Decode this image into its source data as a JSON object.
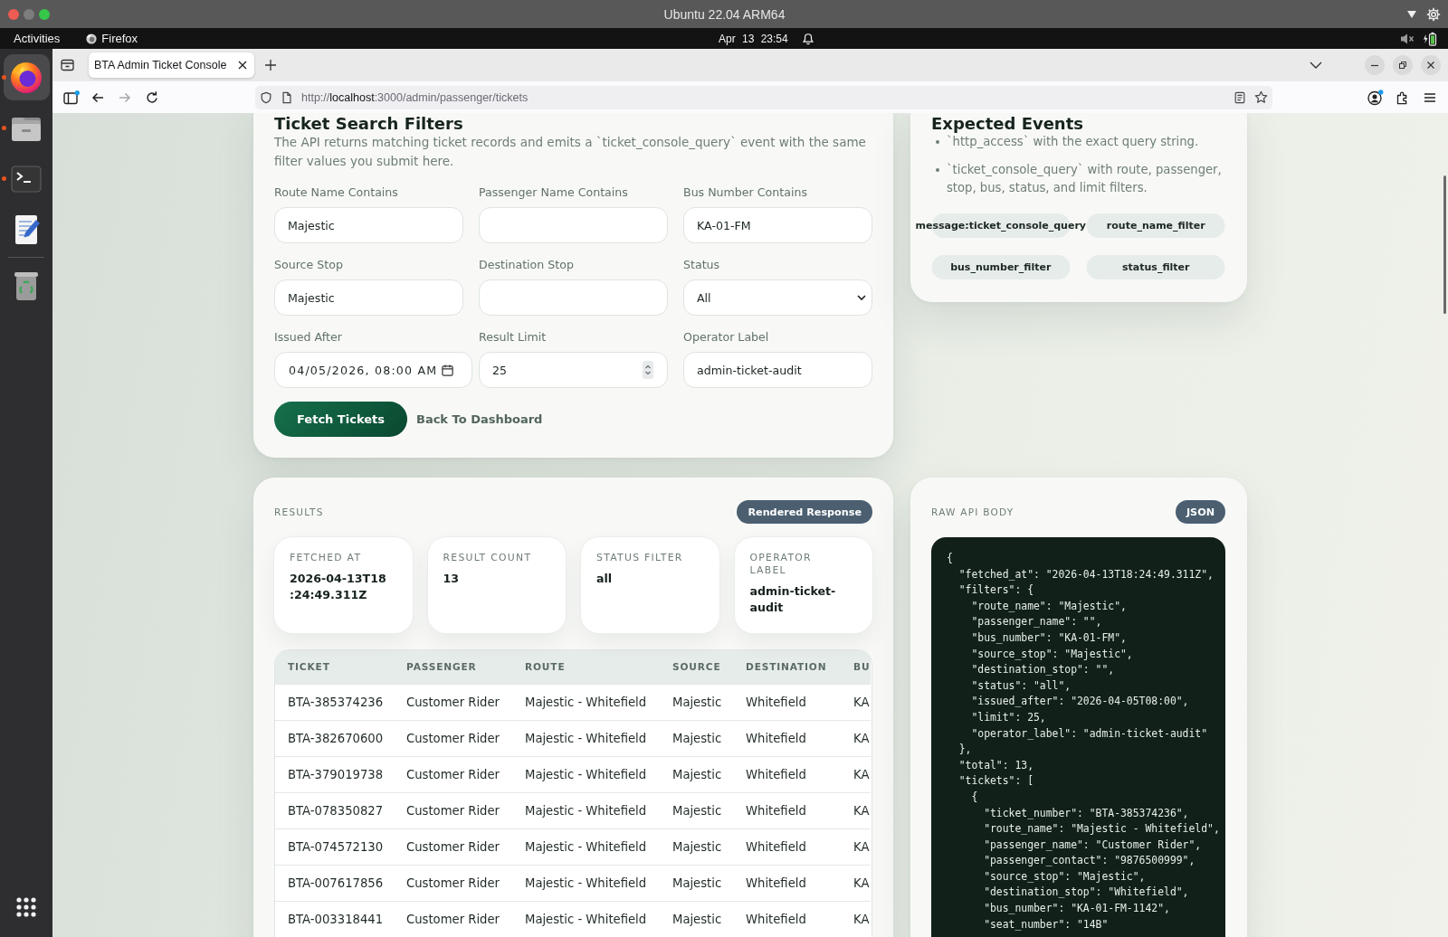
{
  "system_bar": {
    "title": "Ubuntu 22.04 ARM64"
  },
  "top_panel": {
    "activities": "Activities",
    "app_name": "Firefox",
    "clock": "Apr 13 23:54"
  },
  "dock": {
    "items": [
      {
        "kind": "browser",
        "selected": true,
        "running": true
      },
      {
        "kind": "files",
        "selected": false,
        "running": true
      },
      {
        "kind": "terminal",
        "selected": false,
        "running": true
      },
      {
        "kind": "editor",
        "selected": false,
        "running": false
      },
      {
        "kind": "trash",
        "selected": false,
        "running": false
      }
    ]
  },
  "browser": {
    "tabs": [
      {
        "title": "BTA Admin Ticket Console",
        "selected": true
      }
    ],
    "address": {
      "scheme": "http://",
      "host": "localhost",
      "path": ":3000/admin/passenger/tickets"
    }
  },
  "filters": {
    "heading": "Ticket Search Filters",
    "description": "The API returns matching ticket records and emits a `ticket_console_query` event with the same filter values you submit here.",
    "fields": [
      {
        "kind": "text",
        "label": "Route Name Contains",
        "value": "Majestic"
      },
      {
        "kind": "text",
        "label": "Passenger Name Contains"
      },
      {
        "kind": "text",
        "label": "Bus Number Contains",
        "value": "KA-01-FM"
      },
      {
        "kind": "text",
        "label": "Source Stop",
        "value": "Majestic"
      },
      {
        "kind": "text",
        "label": "Destination Stop"
      },
      {
        "kind": "select",
        "label": "Status",
        "value": "All"
      },
      {
        "kind": "datetime",
        "label": "Issued After",
        "value": "04/05/2026, 08:00 AM"
      },
      {
        "kind": "number",
        "label": "Result Limit",
        "value": "25"
      },
      {
        "kind": "text",
        "label": "Operator Label",
        "value": "admin-ticket-audit"
      }
    ],
    "actions": [
      {
        "kind": "primary",
        "label": "Fetch Tickets"
      },
      {
        "kind": "link",
        "label": "Back To Dashboard"
      }
    ]
  },
  "events": {
    "heading": "Expected Events",
    "items": [
      "`http_access` with the exact query string.",
      "`ticket_console_query` with route, passenger, stop, bus, status, and limit filters."
    ],
    "tags": [
      "message:ticket_console_query",
      "route_name_filter",
      "bus_number_filter",
      "status_filter"
    ]
  },
  "results": {
    "label": "RESULTS",
    "badge": "Rendered Response",
    "stats": [
      {
        "kind": "timestamp",
        "label": "FETCHED AT",
        "value": "2026-04-13T18:24:49.311Z"
      },
      {
        "kind": "text",
        "label": "RESULT COUNT",
        "value": "13"
      },
      {
        "kind": "text",
        "label": "STATUS FILTER",
        "value": "all"
      },
      {
        "kind": "text",
        "label": "OPERATOR LABEL",
        "value": "admin-ticket-audit"
      }
    ],
    "table": {
      "columns": [
        "TICKET",
        "PASSENGER",
        "ROUTE",
        "SOURCE",
        "DESTINATION",
        "BU"
      ],
      "rows": [
        [
          "BTA-385374236",
          "Customer Rider",
          "Majestic - Whitefield",
          "Majestic",
          "Whitefield",
          "KA"
        ],
        [
          "BTA-382670600",
          "Customer Rider",
          "Majestic - Whitefield",
          "Majestic",
          "Whitefield",
          "KA"
        ],
        [
          "BTA-379019738",
          "Customer Rider",
          "Majestic - Whitefield",
          "Majestic",
          "Whitefield",
          "KA"
        ],
        [
          "BTA-078350827",
          "Customer Rider",
          "Majestic - Whitefield",
          "Majestic",
          "Whitefield",
          "KA"
        ],
        [
          "BTA-074572130",
          "Customer Rider",
          "Majestic - Whitefield",
          "Majestic",
          "Whitefield",
          "KA"
        ],
        [
          "BTA-007617856",
          "Customer Rider",
          "Majestic - Whitefield",
          "Majestic",
          "Whitefield",
          "KA"
        ],
        [
          "BTA-003318441",
          "Customer Rider",
          "Majestic - Whitefield",
          "Majestic",
          "Whitefield",
          "KA"
        ]
      ]
    }
  },
  "raw_body": {
    "label": "RAW API BODY",
    "badge": "JSON",
    "lines": [
      "{",
      "  \"fetched_at\": \"2026-04-13T18:24:49.311Z\",",
      "  \"filters\": {",
      "    \"route_name\": \"Majestic\",",
      "    \"passenger_name\": \"\",",
      "    \"bus_number\": \"KA-01-FM\",",
      "    \"source_stop\": \"Majestic\",",
      "    \"destination_stop\": \"\",",
      "    \"status\": \"all\",",
      "    \"issued_after\": \"2026-04-05T08:00\",",
      "    \"limit\": 25,",
      "    \"operator_label\": \"admin-ticket-audit\"",
      "  },",
      "  \"total\": 13,",
      "  \"tickets\": [",
      "    {",
      "      \"ticket_number\": \"BTA-385374236\",",
      "      \"route_name\": \"Majestic - Whitefield\",",
      "      \"passenger_name\": \"Customer Rider\",",
      "      \"passenger_contact\": \"9876500999\",",
      "      \"source_stop\": \"Majestic\",",
      "      \"destination_stop\": \"Whitefield\",",
      "      \"bus_number\": \"KA-01-FM-1142\",",
      "      \"seat_number\": \"14B\""
    ]
  }
}
